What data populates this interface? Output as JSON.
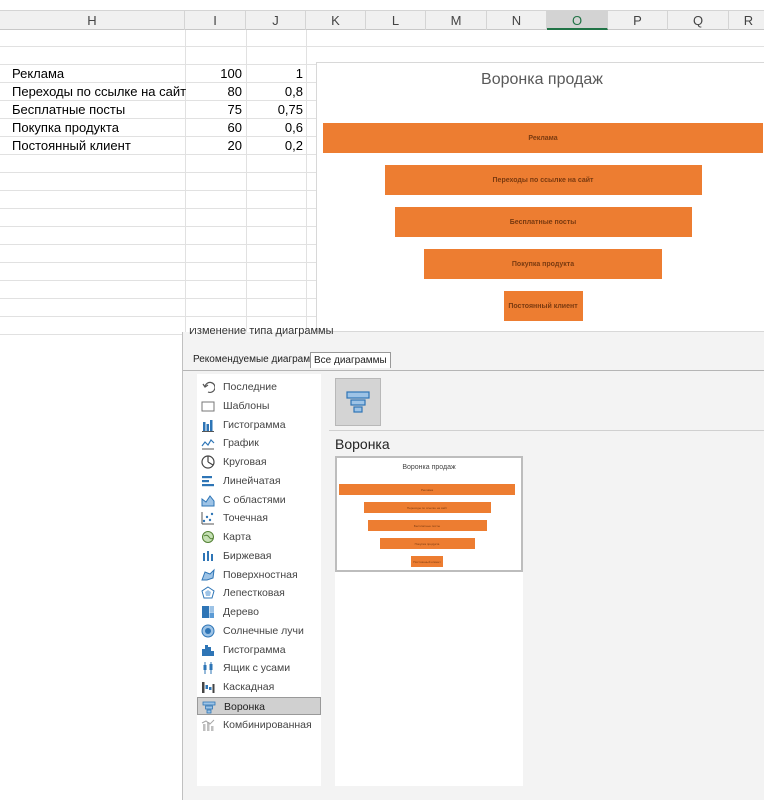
{
  "sheet": {
    "columns": [
      {
        "id": "h",
        "label": "H"
      },
      {
        "id": "i",
        "label": "I"
      },
      {
        "id": "j",
        "label": "J"
      },
      {
        "id": "k",
        "label": "K"
      },
      {
        "id": "l",
        "label": "L"
      },
      {
        "id": "m",
        "label": "M"
      },
      {
        "id": "n",
        "label": "N"
      },
      {
        "id": "o",
        "label": "O"
      },
      {
        "id": "p",
        "label": "P"
      },
      {
        "id": "q",
        "label": "Q"
      },
      {
        "id": "r",
        "label": "R"
      }
    ],
    "selected_column": "O",
    "rows": [
      {
        "label": "Реклама",
        "value": "100",
        "ratio": "1"
      },
      {
        "label": "Переходы по ссылке на сайт",
        "value": "80",
        "ratio": "0,8"
      },
      {
        "label": "Бесплатные посты",
        "value": "75",
        "ratio": "0,75"
      },
      {
        "label": "Покупка продукта",
        "value": "60",
        "ratio": "0,6"
      },
      {
        "label": "Постоянный клиент",
        "value": "20",
        "ratio": "0,2"
      }
    ]
  },
  "chart_data": {
    "type": "bar",
    "subtype": "funnel",
    "title": "Воронка продаж",
    "categories": [
      "Реклама",
      "Переходы по ссылке на сайт",
      "Бесплатные посты",
      "Покупка продукта",
      "Постоянный клиент"
    ],
    "values": [
      100,
      80,
      75,
      60,
      20
    ],
    "color": "#ED7D31"
  },
  "dialog": {
    "title": "Изменение типа диаграммы",
    "tabs": [
      "Рекомендуемые диаграммы",
      "Все диаграммы"
    ],
    "active_tab": "Все диаграммы",
    "chart_types": [
      {
        "label": "Последние",
        "icon": "recent-icon"
      },
      {
        "label": "Шаблоны",
        "icon": "folder-icon"
      },
      {
        "label": "Гистограмма",
        "icon": "column-chart-icon"
      },
      {
        "label": "График",
        "icon": "line-chart-icon"
      },
      {
        "label": "Круговая",
        "icon": "pie-chart-icon"
      },
      {
        "label": "Линейчатая",
        "icon": "bar-chart-icon"
      },
      {
        "label": "С областями",
        "icon": "area-chart-icon"
      },
      {
        "label": "Точечная",
        "icon": "scatter-chart-icon"
      },
      {
        "label": "Карта",
        "icon": "map-chart-icon"
      },
      {
        "label": "Биржевая",
        "icon": "stock-chart-icon"
      },
      {
        "label": "Поверхностная",
        "icon": "surface-chart-icon"
      },
      {
        "label": "Лепестковая",
        "icon": "radar-chart-icon"
      },
      {
        "label": "Дерево",
        "icon": "treemap-chart-icon"
      },
      {
        "label": "Солнечные лучи",
        "icon": "sunburst-chart-icon"
      },
      {
        "label": "Гистограмма",
        "icon": "histogram-chart-icon"
      },
      {
        "label": "Ящик с усами",
        "icon": "box-whisker-chart-icon"
      },
      {
        "label": "Каскадная",
        "icon": "waterfall-chart-icon"
      },
      {
        "label": "Воронка",
        "icon": "funnel-chart-icon"
      },
      {
        "label": "Комбинированная",
        "icon": "combo-chart-icon"
      }
    ],
    "selected_type": "Воронка",
    "section_title": "Воронка",
    "preview_title": "Воронка продаж"
  },
  "colors": {
    "accent": "#ED7D31",
    "excel_green": "#217346",
    "icon_blue": "#2E75B6"
  }
}
